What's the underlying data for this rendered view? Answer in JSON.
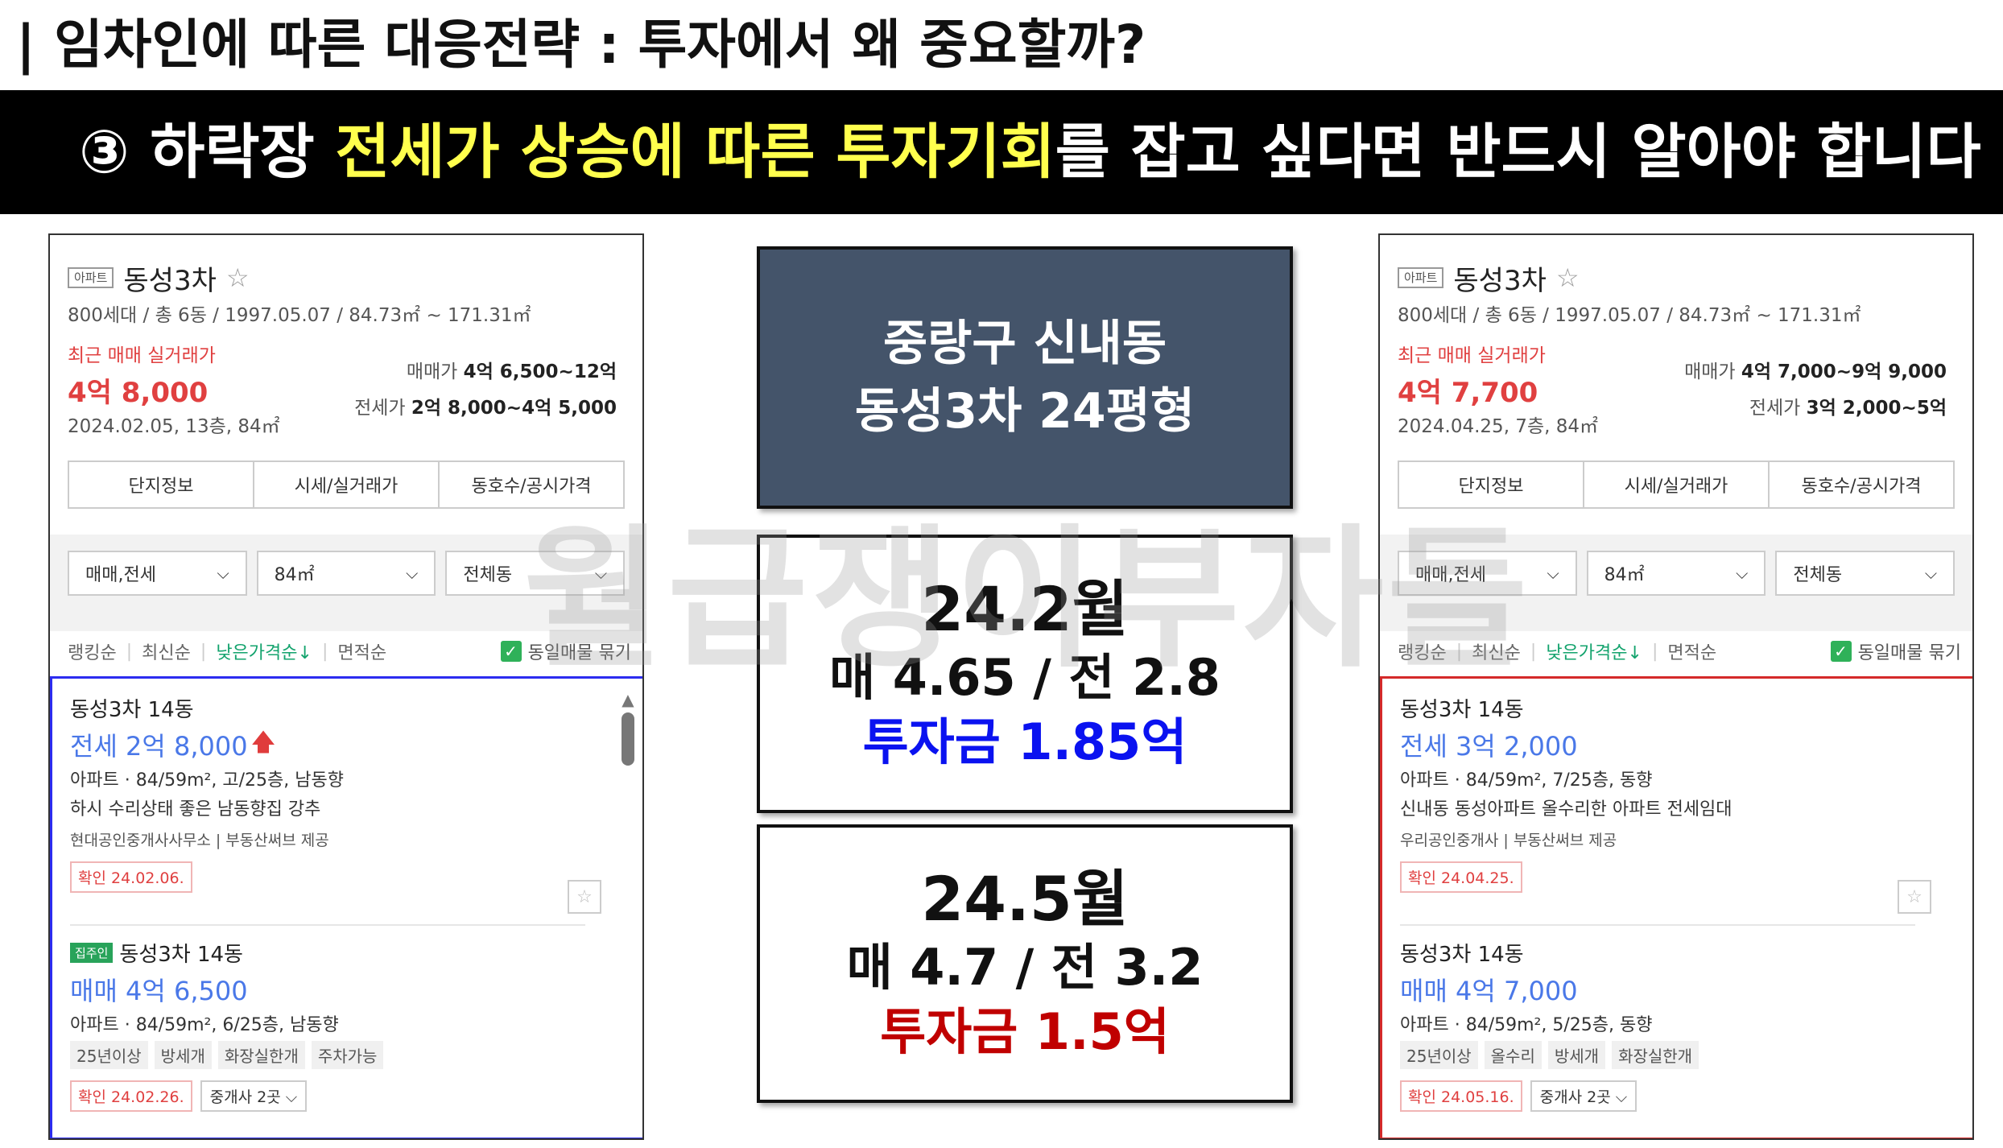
{
  "slide": {
    "title": "| 임차인에 따른 대응전략 : 투자에서 왜 중요할까?",
    "banner": {
      "prefix": "③ 하락장 ",
      "highlight1": "전세가 상승에 따른",
      "middle": " ",
      "highlight2": "투자기회",
      "suffix": "를 잡고 싶다면 반드시 알아야 합니다"
    },
    "watermark": "월급쟁이부자들"
  },
  "center": {
    "title_line1": "중랑구 신내동",
    "title_line2": "동성3차 24평형",
    "feb": {
      "month": "24.2월",
      "price": "매 4.65 / 전 2.8",
      "invest": "투자금 1.85억"
    },
    "may": {
      "month": "24.5월",
      "price": "매 4.7 / 전 3.2",
      "invest": "투자금 1.5억"
    }
  },
  "panels": {
    "left": {
      "tag": "아파트",
      "name": "동성3차",
      "meta": "800세대 / 총 6동 / 1997.05.07 / 84.73㎡ ~ 171.31㎡",
      "recent_label": "최근 매매 실거래가",
      "recent_price": "4억 8,000",
      "recent_date": "2024.02.05, 13층, 84㎡",
      "sale_label": "매매가",
      "sale_range": "4억 6,500~12억",
      "lease_label": "전세가",
      "lease_range": "2억 8,000~4억 5,000",
      "tabs": [
        "단지정보",
        "시세/실거래가",
        "동호수/공시가격"
      ],
      "filters": [
        "매매,전세",
        "84㎡",
        "전체동"
      ],
      "sorts": [
        "랭킹순",
        "최신순",
        "낮은가격순↓",
        "면적순"
      ],
      "same_listing": "동일매물 묶기",
      "items": [
        {
          "name": "동성3차 14동",
          "price": "전세 2억 8,000",
          "detail": "아파트 · 84/59m², 고/25층, 남동향",
          "desc": "하시 수리상태 좋은 남동향집 강추",
          "agent": "현대공인중개사사무소 | 부동산써브 제공",
          "confirm": "확인 24.02.06."
        },
        {
          "owner_tag": "집주인",
          "name": "동성3차 14동",
          "price": "매매 4억 6,500",
          "detail": "아파트 · 84/59m², 6/25층, 남동향",
          "chips": [
            "25년이상",
            "방세개",
            "화장실한개",
            "주차가능"
          ],
          "confirm": "확인 24.02.26.",
          "agents": "중개사 2곳 ⌵"
        }
      ]
    },
    "right": {
      "tag": "아파트",
      "name": "동성3차",
      "meta": "800세대 / 총 6동 / 1997.05.07 / 84.73㎡ ~ 171.31㎡",
      "recent_label": "최근 매매 실거래가",
      "recent_price": "4억 7,700",
      "recent_date": "2024.04.25, 7층, 84㎡",
      "sale_label": "매매가",
      "sale_range": "4억 7,000~9억 9,000",
      "lease_label": "전세가",
      "lease_range": "3억 2,000~5억",
      "tabs": [
        "단지정보",
        "시세/실거래가",
        "동호수/공시가격"
      ],
      "filters": [
        "매매,전세",
        "84㎡",
        "전체동"
      ],
      "sorts": [
        "랭킹순",
        "최신순",
        "낮은가격순↓",
        "면적순"
      ],
      "same_listing": "동일매물 묶기",
      "items": [
        {
          "name": "동성3차 14동",
          "price": "전세 3억 2,000",
          "detail": "아파트 · 84/59m², 7/25층, 동향",
          "desc": "신내동 동성아파트 올수리한 아파트 전세임대",
          "agent": "우리공인중개사 | 부동산써브 제공",
          "confirm": "확인 24.04.25."
        },
        {
          "name": "동성3차 14동",
          "price": "매매 4억 7,000",
          "detail": "아파트 · 84/59m², 5/25층, 동향",
          "chips": [
            "25년이상",
            "올수리",
            "방세개",
            "화장실한개"
          ],
          "confirm": "확인 24.05.16.",
          "agents": "중개사 2곳 ⌵"
        }
      ]
    }
  },
  "colors": {
    "banner_bg": "#000000",
    "banner_highlight": "#ffff4d",
    "title_card": "#44546a",
    "left_list_border": "#2c2cf0",
    "right_list_border": "#d42a2a",
    "invest_blue": "#0a12f0",
    "invest_red": "#c00000",
    "price_red": "#e04040",
    "listing_blue": "#4a78e8",
    "sort_green": "#13a36d"
  },
  "icons": [
    "star-icon",
    "chevron-down-icon",
    "check-icon",
    "up-arrow-icon",
    "scroll-up-icon"
  ]
}
